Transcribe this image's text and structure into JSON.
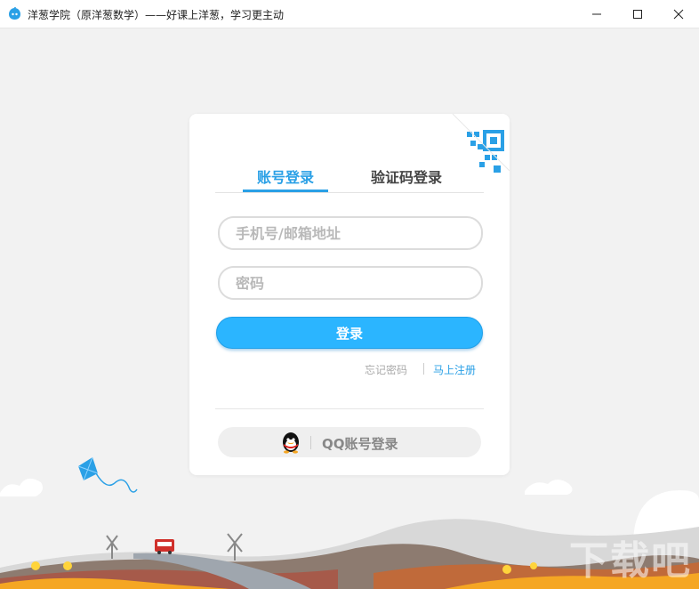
{
  "window": {
    "title": "洋葱学院（原洋葱数学）——好课上洋葱，学习更主动"
  },
  "login": {
    "tabs": [
      {
        "label": "账号登录",
        "active": true
      },
      {
        "label": "验证码登录",
        "active": false
      }
    ],
    "account_placeholder": "手机号/邮箱地址",
    "password_placeholder": "密码",
    "login_button": "登录",
    "forgot_password": "忘记密码",
    "register": "马上注册",
    "qq_login": "QQ账号登录"
  },
  "watermark": "下载吧",
  "colors": {
    "accent": "#2aa0e6",
    "button": "#2bb5ff",
    "background": "#f2f2f2"
  },
  "icons": [
    "app-logo-icon",
    "minimize-icon",
    "maximize-icon",
    "close-icon",
    "qr-code-icon",
    "qq-penguin-icon"
  ]
}
